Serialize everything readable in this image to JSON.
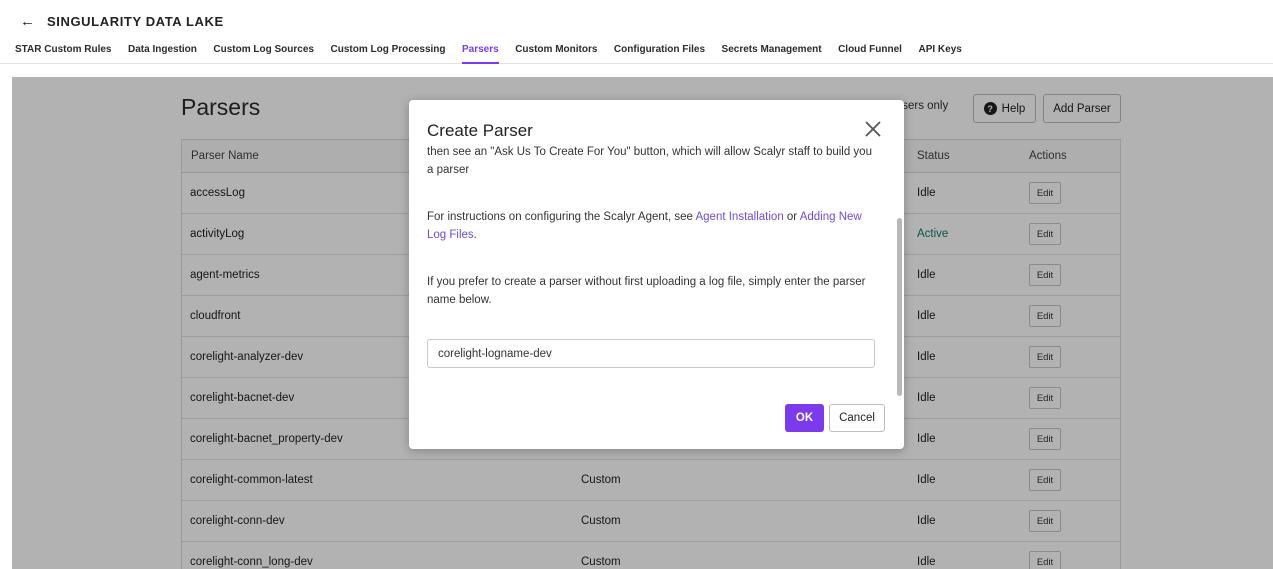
{
  "header": {
    "back_icon": "arrow-left-icon",
    "title": "SINGULARITY DATA LAKE",
    "tabs": [
      {
        "label": "STAR Custom Rules"
      },
      {
        "label": "Data Ingestion"
      },
      {
        "label": "Custom Log Sources"
      },
      {
        "label": "Custom Log Processing"
      },
      {
        "label": "Parsers",
        "active": true
      },
      {
        "label": "Custom Monitors"
      },
      {
        "label": "Configuration Files"
      },
      {
        "label": "Secrets Management"
      },
      {
        "label": "Cloud Funnel"
      },
      {
        "label": "API Keys"
      }
    ]
  },
  "page": {
    "title": "Parsers",
    "filter_text": "arsers only",
    "help_label": "Help",
    "add_parser_label": "Add Parser"
  },
  "table": {
    "columns": {
      "name": "Parser Name",
      "status": "Status",
      "actions": "Actions"
    },
    "edit_label": "Edit",
    "rows": [
      {
        "name": "accessLog",
        "type": "",
        "status": "Idle"
      },
      {
        "name": "activityLog",
        "type": "",
        "status": "Active"
      },
      {
        "name": "agent-metrics",
        "type": "",
        "status": "Idle"
      },
      {
        "name": "cloudfront",
        "type": "",
        "status": "Idle"
      },
      {
        "name": "corelight-analyzer-dev",
        "type": "",
        "status": "Idle"
      },
      {
        "name": "corelight-bacnet-dev",
        "type": "",
        "status": "Idle"
      },
      {
        "name": "corelight-bacnet_property-dev",
        "type": "",
        "status": "Idle"
      },
      {
        "name": "corelight-common-latest",
        "type": "Custom",
        "status": "Idle"
      },
      {
        "name": "corelight-conn-dev",
        "type": "Custom",
        "status": "Idle"
      },
      {
        "name": "corelight-conn_long-dev",
        "type": "Custom",
        "status": "Idle"
      }
    ]
  },
  "modal": {
    "title": "Create Parser",
    "close_icon": "close-icon",
    "para1": "then see an \"Ask Us To Create For You\" button, which will allow Scalyr staff to build you a parser",
    "para2_prefix": "For instructions on configuring the Scalyr Agent, see ",
    "para2_link1": "Agent Installation",
    "para2_mid": " or ",
    "para2_link2": "Adding New Log Files",
    "para2_suffix": ".",
    "para3": "If you prefer to create a parser without first uploading a log file, simply enter the parser name below.",
    "input_value": "corelight-logname-dev",
    "ok_label": "OK",
    "cancel_label": "Cancel"
  }
}
